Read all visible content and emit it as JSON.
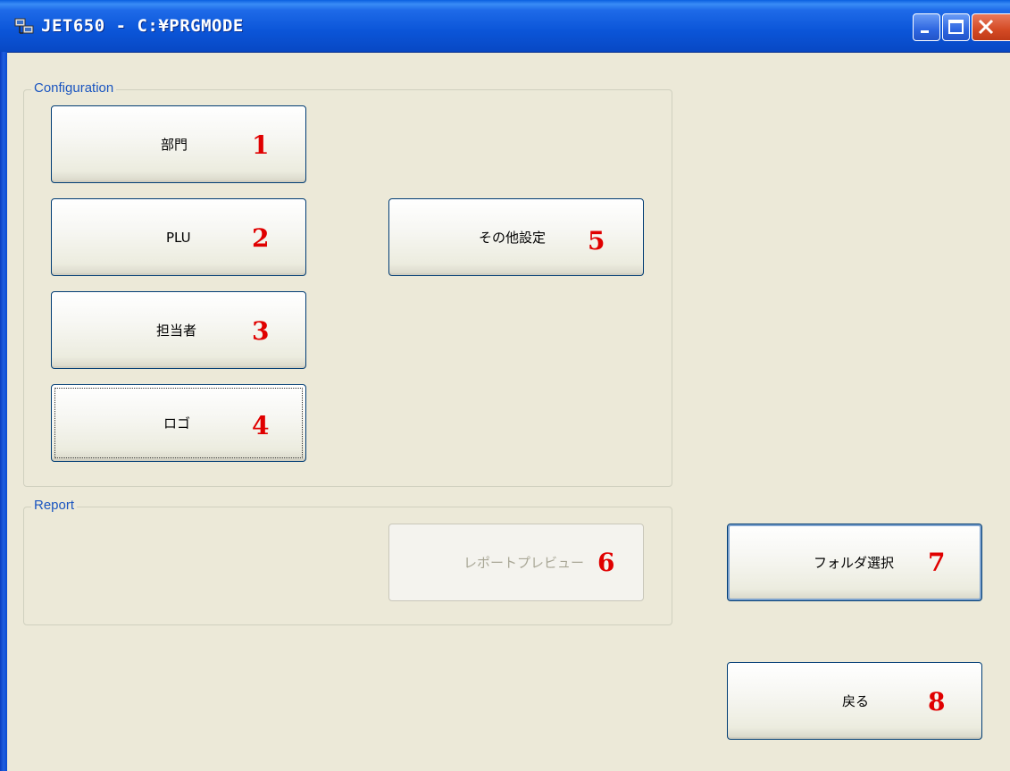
{
  "window": {
    "title": "JET650 - C:¥PRGMODE"
  },
  "groups": {
    "configuration": {
      "label": "Configuration"
    },
    "report": {
      "label": "Report"
    }
  },
  "buttons": {
    "department": {
      "label": "部門",
      "marker": "1"
    },
    "plu": {
      "label": "PLU",
      "marker": "2"
    },
    "staff": {
      "label": "担当者",
      "marker": "3"
    },
    "logo": {
      "label": "ロゴ",
      "marker": "4"
    },
    "other_settings": {
      "label": "その他設定",
      "marker": "5"
    },
    "report_preview": {
      "label": "レポートプレビュー",
      "marker": "6",
      "enabled": false
    },
    "folder_select": {
      "label": "フォルダ選択",
      "marker": "7"
    },
    "back": {
      "label": "戻る",
      "marker": "8"
    }
  },
  "colors": {
    "titlebar": "#0b55d8",
    "background": "#ece9d8",
    "group_label": "#1a55c0",
    "marker": "#e00000",
    "button_border": "#003c74"
  },
  "icons": {
    "app": "network-computer-icon",
    "minimize": "minimize-icon",
    "maximize": "maximize-icon",
    "close": "close-icon"
  }
}
